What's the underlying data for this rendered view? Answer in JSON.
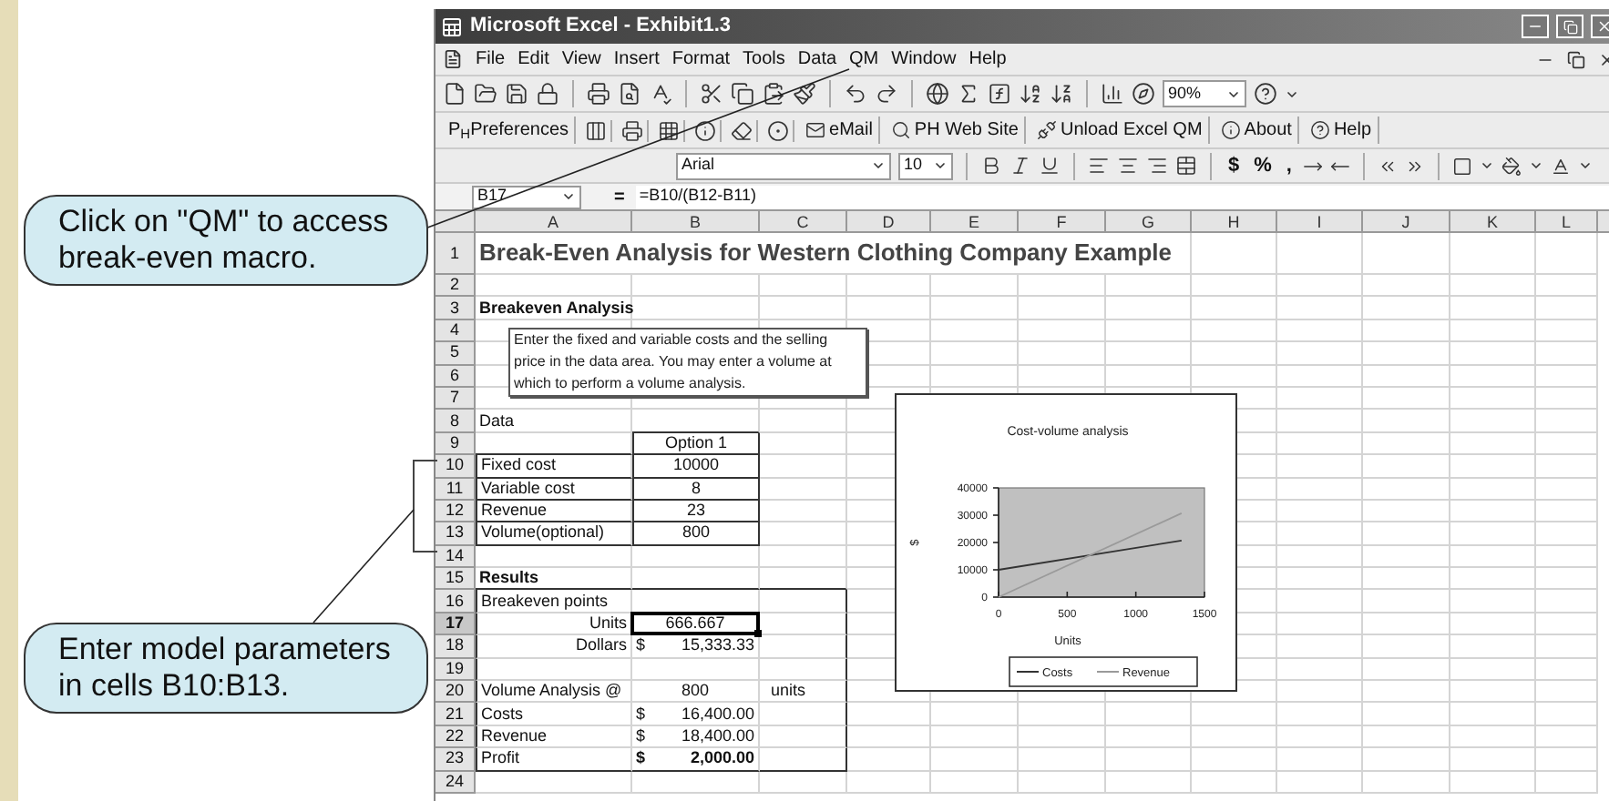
{
  "window": {
    "title": "Microsoft Excel - Exhibit1.3"
  },
  "menu": [
    "File",
    "Edit",
    "View",
    "Insert",
    "Format",
    "Tools",
    "Data",
    "QM",
    "Window",
    "Help"
  ],
  "standard_toolbar": {
    "zoom": "90%"
  },
  "qm_toolbar": [
    "P$_{H}$Preferences",
    "eMail",
    "PH Web Site",
    "Unload Excel QM",
    "About",
    "Help"
  ],
  "format_toolbar": {
    "font": "Arial",
    "size": "10",
    "symbols": [
      "$",
      "%",
      ","
    ]
  },
  "formula_bar": {
    "name_box": "B17",
    "equals": "=",
    "formula": "=B10/(B12-B11)"
  },
  "columns": [
    "A",
    "B",
    "C",
    "D",
    "E",
    "F",
    "G",
    "H",
    "I",
    "J",
    "K",
    "L"
  ],
  "rows": [
    {
      "number": "1",
      "a": "Break-Even Analysis for Western Clothing Company Example",
      "kind": "title",
      "selected": false
    },
    {
      "number": "2",
      "selected": false
    },
    {
      "number": "3",
      "a": "Breakeven Analysis",
      "kind": "heading",
      "selected": false
    },
    {
      "number": "4",
      "selected": false
    },
    {
      "number": "5",
      "selected": false
    },
    {
      "number": "6",
      "selected": false
    },
    {
      "number": "7",
      "selected": false
    },
    {
      "number": "8",
      "a": "Data",
      "kind": "plain",
      "selected": false
    },
    {
      "number": "9",
      "b": "Option 1",
      "selected": false
    },
    {
      "number": "10",
      "a": "Fixed cost",
      "b": "10000",
      "selected": false
    },
    {
      "number": "11",
      "a": "Variable cost",
      "b": "8",
      "selected": false
    },
    {
      "number": "12",
      "a": "Revenue",
      "b": "23",
      "selected": false
    },
    {
      "number": "13",
      "a": "Volume(optional)",
      "b": "800",
      "selected": false
    },
    {
      "number": "14",
      "selected": false
    },
    {
      "number": "15",
      "a": "Results",
      "kind": "heading",
      "selected": false
    },
    {
      "number": "16",
      "a": "Breakeven points",
      "kind": "plain",
      "selected": false
    },
    {
      "number": "17",
      "a": "Units",
      "kind": "result",
      "b": "666.667",
      "selected": true
    },
    {
      "number": "18",
      "a": "Dollars",
      "kind": "result",
      "b_currency": "$",
      "b": "15,333.33",
      "selected": false
    },
    {
      "number": "19",
      "selected": false
    },
    {
      "number": "20",
      "a": "Volume Analysis @",
      "b": "800",
      "c": "units",
      "selected": false
    },
    {
      "number": "21",
      "a": "Costs",
      "b_currency": "$",
      "b": "16,400.00",
      "selected": false
    },
    {
      "number": "22",
      "a": "Revenue",
      "b_currency": "$",
      "b": "18,400.00",
      "selected": false
    },
    {
      "number": "23",
      "a": "Profit",
      "kind": "total",
      "b_currency": "$",
      "b": "2,000.00",
      "selected": false
    },
    {
      "number": "24",
      "selected": false
    }
  ],
  "text_box": "Enter the fixed and variable costs and the selling price in the data area. You may enter a volume at which to perform a volume analysis.",
  "chart": {
    "chart_data": {
      "type": "line",
      "title": "Cost-volume analysis",
      "xlabel": "Units",
      "ylabel": "$",
      "x": [
        0,
        1333
      ],
      "series": [
        {
          "name": "Costs",
          "color": "#333333",
          "values": [
            10000,
            20700
          ]
        },
        {
          "name": "Revenue",
          "color": "#9a9a9a",
          "values": [
            0,
            30700
          ]
        }
      ],
      "legend": "bottom",
      "xlim": [
        0,
        1500
      ],
      "ylim": [
        0,
        40000
      ],
      "xticks": [
        0,
        500,
        1000,
        1500
      ],
      "yticks": [
        0,
        10000,
        20000,
        30000,
        40000
      ]
    }
  },
  "callouts": [
    "Click on \"QM\" to access break-even macro.",
    "Enter model parameters in cells B10:B13."
  ]
}
